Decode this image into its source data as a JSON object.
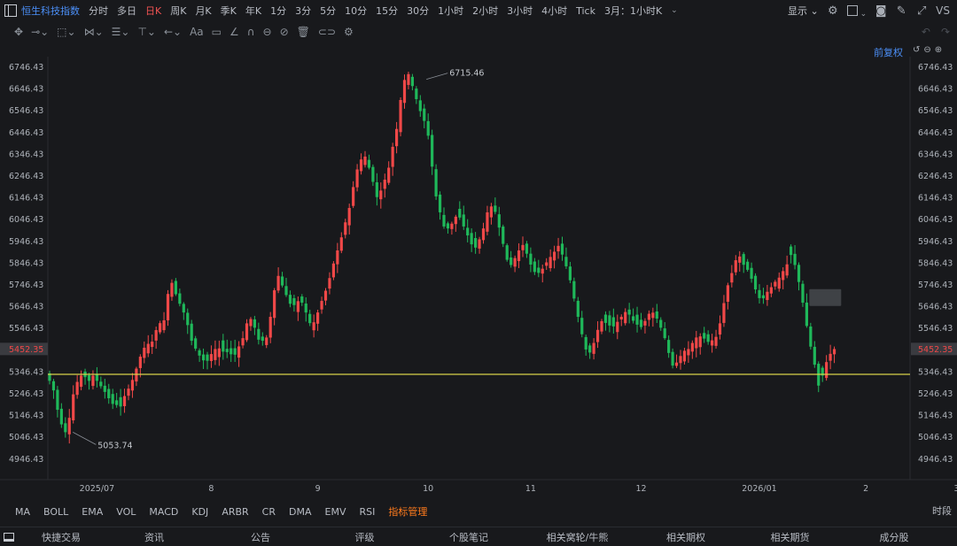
{
  "symbol": "恒生科技指数",
  "timeframes": [
    {
      "label": "分时",
      "active": false
    },
    {
      "label": "多日",
      "active": false
    },
    {
      "label": "日K",
      "active": true
    },
    {
      "label": "周K",
      "active": false
    },
    {
      "label": "月K",
      "active": false
    },
    {
      "label": "季K",
      "active": false
    },
    {
      "label": "年K",
      "active": false
    },
    {
      "label": "1分",
      "active": false
    },
    {
      "label": "3分",
      "active": false
    },
    {
      "label": "5分",
      "active": false
    },
    {
      "label": "10分",
      "active": false
    },
    {
      "label": "15分",
      "active": false
    },
    {
      "label": "30分",
      "active": false
    },
    {
      "label": "1小时",
      "active": false
    },
    {
      "label": "2小时",
      "active": false
    },
    {
      "label": "3小时",
      "active": false
    },
    {
      "label": "4小时",
      "active": false
    },
    {
      "label": "Tick",
      "active": false
    },
    {
      "label": "3月：1小时K",
      "active": false
    }
  ],
  "toolbar": {
    "show_label": "显示",
    "vs_label": "VS"
  },
  "adjust_label": "前复权",
  "chart_data": {
    "type": "candlestick",
    "y_ticks": [
      "6746.43",
      "6646.43",
      "6546.43",
      "6446.43",
      "6346.43",
      "6246.43",
      "6146.43",
      "6046.43",
      "5946.43",
      "5846.43",
      "5746.43",
      "5646.43",
      "5546.43",
      "5446.43",
      "5346.43",
      "5246.43",
      "5146.43",
      "5046.43",
      "4946.43"
    ],
    "y_tick_values": [
      6746.43,
      6646.43,
      6546.43,
      6446.43,
      6346.43,
      6246.43,
      6146.43,
      6046.43,
      5946.43,
      5846.43,
      5746.43,
      5646.43,
      5546.43,
      5446.43,
      5346.43,
      5246.43,
      5146.43,
      5046.43,
      4946.43
    ],
    "ylim": [
      4900,
      6800
    ],
    "x_labels": [
      "2025/07",
      "8",
      "9",
      "10",
      "11",
      "12",
      "2026/01",
      "2",
      "3"
    ],
    "x_label_index": [
      12,
      41,
      68,
      96,
      122,
      150,
      180,
      207,
      230
    ],
    "current_price_label": "5452.35",
    "current_price": 5452.35,
    "support_line": 5336,
    "high_label": "6715.46",
    "high_value": 6715.46,
    "high_index": 96,
    "low_label": "5053.74",
    "low_value": 5053.74,
    "low_index": 5,
    "candles_close": [
      5306,
      5262,
      5173,
      5106,
      5070,
      5136,
      5244,
      5301,
      5330,
      5323,
      5306,
      5330,
      5306,
      5281,
      5255,
      5226,
      5200,
      5195,
      5188,
      5236,
      5270,
      5310,
      5362,
      5417,
      5458,
      5476,
      5486,
      5539,
      5571,
      5584,
      5705,
      5756,
      5704,
      5660,
      5620,
      5562,
      5490,
      5454,
      5422,
      5400,
      5398,
      5429,
      5452,
      5455,
      5440,
      5438,
      5428,
      5426,
      5464,
      5502,
      5570,
      5590,
      5550,
      5495,
      5490,
      5505,
      5600,
      5722,
      5788,
      5744,
      5700,
      5660,
      5654,
      5672,
      5665,
      5620,
      5571,
      5575,
      5620,
      5673,
      5720,
      5778,
      5845,
      5905,
      5965,
      6034,
      6100,
      6196,
      6277,
      6323,
      6336,
      6285,
      6220,
      6150,
      6180,
      6230,
      6285,
      6381,
      6463,
      6596,
      6688,
      6715,
      6660,
      6600,
      6545,
      6500,
      6432,
      6290,
      6153,
      6080,
      6015,
      6006,
      6028,
      6060,
      6056,
      6015,
      5974,
      5933,
      5918,
      5956,
      6006,
      6080,
      6107,
      6082,
      6010,
      5935,
      5862,
      5838,
      5870,
      5905,
      5930,
      5890,
      5840,
      5806,
      5802,
      5821,
      5850,
      5875,
      5899,
      5926,
      5886,
      5832,
      5768,
      5684,
      5600,
      5520,
      5450,
      5436,
      5480,
      5540,
      5580,
      5572,
      5560,
      5556,
      5577,
      5600,
      5622,
      5610,
      5582,
      5564,
      5553,
      5581,
      5614,
      5619,
      5592,
      5550,
      5502,
      5434,
      5376,
      5390,
      5420,
      5444,
      5452,
      5480,
      5505,
      5510,
      5500,
      5485,
      5492,
      5508,
      5570,
      5663,
      5745,
      5801,
      5860,
      5877,
      5839,
      5816,
      5775,
      5726,
      5686,
      5685,
      5715,
      5736,
      5761,
      5780,
      5810,
      5841,
      5884,
      5838,
      5760,
      5665,
      5558,
      5463,
      5380,
      5284,
      5330,
      5392,
      5430,
      5452
    ],
    "candles_up": [
      0,
      0,
      0,
      0,
      0,
      1,
      1,
      1,
      1,
      0,
      0,
      1,
      0,
      0,
      0,
      0,
      0,
      0,
      0,
      1,
      1,
      1,
      1,
      1,
      1,
      1,
      1,
      1,
      1,
      1,
      1,
      1,
      0,
      0,
      0,
      0,
      0,
      0,
      0,
      0,
      0,
      1,
      1,
      1,
      0,
      0,
      0,
      0,
      1,
      1,
      1,
      1,
      0,
      0,
      0,
      1,
      1,
      1,
      1,
      0,
      0,
      0,
      0,
      1,
      0,
      0,
      0,
      1,
      1,
      1,
      1,
      1,
      1,
      1,
      1,
      1,
      1,
      1,
      1,
      1,
      1,
      0,
      0,
      0,
      1,
      1,
      1,
      1,
      1,
      1,
      1,
      1,
      0,
      0,
      0,
      0,
      0,
      0,
      0,
      0,
      0,
      0,
      1,
      1,
      0,
      0,
      0,
      0,
      0,
      1,
      1,
      1,
      1,
      0,
      0,
      0,
      0,
      0,
      1,
      1,
      1,
      0,
      0,
      0,
      0,
      1,
      1,
      1,
      1,
      1,
      0,
      0,
      0,
      0,
      0,
      0,
      0,
      0,
      1,
      1,
      1,
      0,
      0,
      0,
      1,
      1,
      1,
      0,
      0,
      0,
      0,
      1,
      1,
      1,
      0,
      0,
      0,
      0,
      0,
      1,
      1,
      1,
      1,
      1,
      1,
      1,
      0,
      0,
      1,
      1,
      1,
      1,
      1,
      1,
      1,
      1,
      0,
      0,
      0,
      0,
      0,
      0,
      1,
      1,
      1,
      1,
      1,
      1,
      0,
      0,
      0,
      0,
      0,
      0,
      0,
      0,
      0,
      1,
      1,
      1
    ],
    "indicator_box_value": 5670
  },
  "indicators": [
    {
      "label": "MA",
      "active": false
    },
    {
      "label": "BOLL",
      "active": false
    },
    {
      "label": "EMA",
      "active": false
    },
    {
      "label": "VOL",
      "active": false
    },
    {
      "label": "MACD",
      "active": false
    },
    {
      "label": "KDJ",
      "active": false
    },
    {
      "label": "ARBR",
      "active": false
    },
    {
      "label": "CR",
      "active": false
    },
    {
      "label": "DMA",
      "active": false
    },
    {
      "label": "EMV",
      "active": false
    },
    {
      "label": "RSI",
      "active": false
    },
    {
      "label": "指标管理",
      "active": true
    }
  ],
  "timeshare_label": "时段",
  "bottom_items": [
    "快捷交易",
    "资讯",
    "公告",
    "评级",
    "个股笔记",
    "相关窝轮/牛熊",
    "相关期权",
    "相关期货",
    "成分股"
  ],
  "colors": {
    "up": "#f04848",
    "down": "#1fb85a",
    "support": "#d6d24a",
    "accent": "#4b8ff7",
    "active_indicator": "#ff7b1c"
  }
}
